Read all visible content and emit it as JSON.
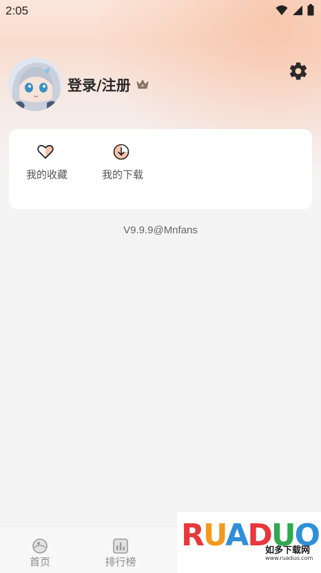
{
  "status_bar": {
    "time": "2:05"
  },
  "profile": {
    "login_label": "登录/注册"
  },
  "quick_actions": [
    {
      "label": "我的收藏",
      "icon": "heart-icon"
    },
    {
      "label": "我的下载",
      "icon": "download-icon"
    }
  ],
  "version": "V9.9.9@Mnfans",
  "bottom_nav": [
    {
      "label": "首页",
      "icon": "home-icon"
    },
    {
      "label": "排行榜",
      "icon": "ranking-icon"
    }
  ],
  "watermark": {
    "brand_letters": [
      "R",
      "U",
      "A",
      "D",
      "U",
      "O"
    ],
    "brand_letter_colors": [
      "#e8383d",
      "#f39a1c",
      "#2f8fd8",
      "#e8383d",
      "#2fa84f",
      "#2f8fd8"
    ],
    "chinese": "如多下载网",
    "url": "www.ruaduo.com"
  },
  "colors": {
    "accent": "#f3a27c",
    "text_dark": "#2a2a2a"
  }
}
